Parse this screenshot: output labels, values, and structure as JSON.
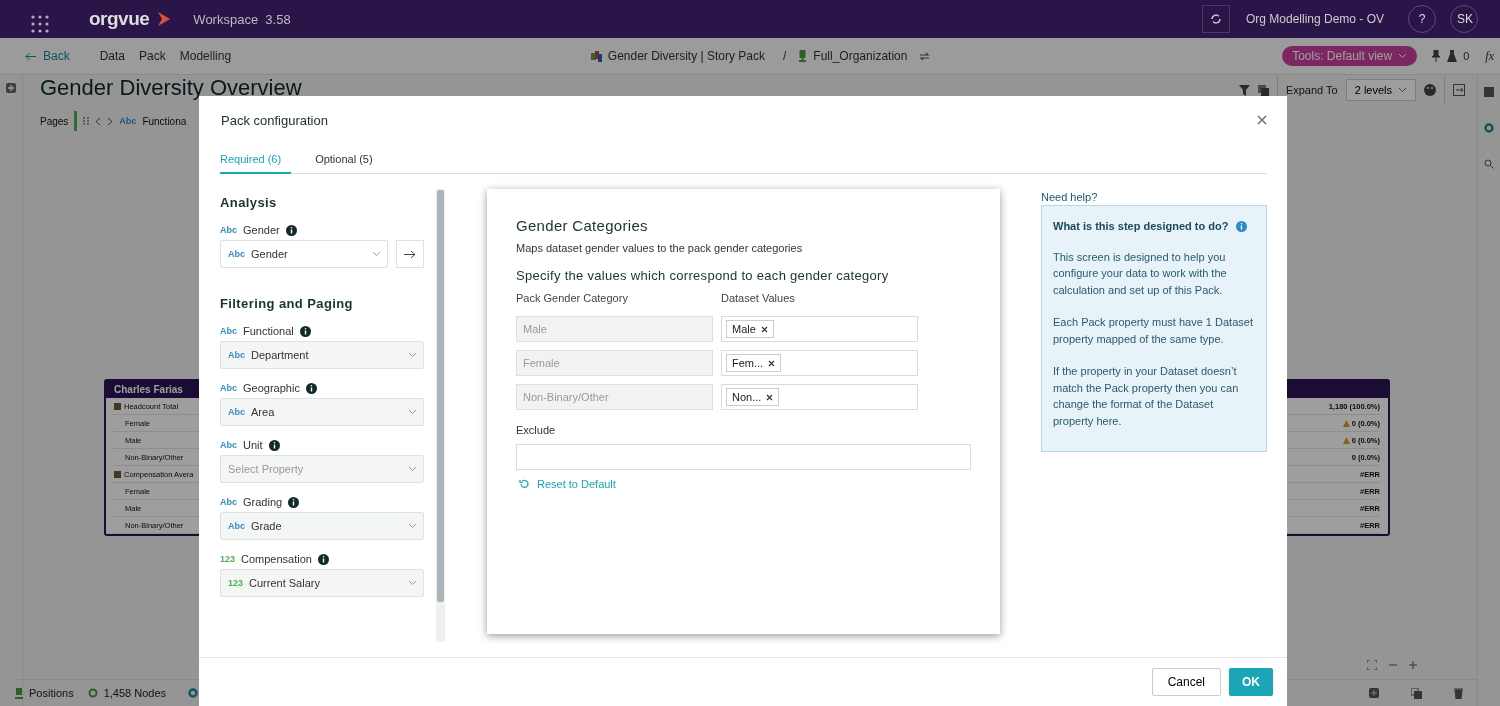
{
  "app_bar": {
    "brand": "orgvue",
    "workspace": "Workspace  3.58",
    "project": "Org Modelling Demo - OV",
    "help": "?",
    "avatar": "SK"
  },
  "nav": {
    "back": "Back",
    "menu": [
      "Data",
      "Pack",
      "Modelling"
    ],
    "pack": "Gender Diversity | Story Pack",
    "separator": "/",
    "dataset": "Full_Organization",
    "tools": "Tools: Default view",
    "flask_count": "0",
    "fx": "fx"
  },
  "page": {
    "title": "Gender Diversity Overview",
    "pages_label": "Pages",
    "page_tag": "Abc",
    "page_name": "Functiona",
    "expand_label": "Expand To",
    "expand_value": "2 levels"
  },
  "node_card": {
    "name": "Charles Farias",
    "rows": [
      {
        "kind": "metric",
        "label": "Headcount Total",
        "value": "1,180 (100.0%)",
        "warning": false
      },
      {
        "kind": "breakdown",
        "label": "Female",
        "value": "0 (0.0%)",
        "warning": true
      },
      {
        "kind": "breakdown",
        "label": "Male",
        "value": "0 (0.0%)",
        "warning": true
      },
      {
        "kind": "breakdown",
        "label": "Non-Binary/Other",
        "value": "0 (0.0%)",
        "warning": false
      },
      {
        "kind": "metric",
        "label": "Compensation Avera",
        "value": "#ERR",
        "warning": false
      },
      {
        "kind": "breakdown",
        "label": "Female",
        "value": "#ERR",
        "warning": false
      },
      {
        "kind": "breakdown",
        "label": "Male",
        "value": "#ERR",
        "warning": false
      },
      {
        "kind": "breakdown",
        "label": "Non-Binary/Other",
        "value": "#ERR",
        "warning": false
      }
    ]
  },
  "status_bar": {
    "positions": "Positions",
    "nodes": "1,458 Nodes"
  },
  "dialog": {
    "title": "Pack configuration",
    "tabs": [
      {
        "label": "Required (6)",
        "selected": true
      },
      {
        "label": "Optional (5)",
        "selected": false
      }
    ],
    "sections": [
      {
        "heading": "Analysis",
        "fields": [
          {
            "type": "Abc",
            "label": "Gender",
            "value_type": "Abc",
            "value": "Gender",
            "active": true
          }
        ]
      },
      {
        "heading": "Filtering and Paging",
        "fields": [
          {
            "type": "Abc",
            "label": "Functional",
            "value_type": "Abc",
            "value": "Department",
            "active": false
          },
          {
            "type": "Abc",
            "label": "Geographic",
            "value_type": "Abc",
            "value": "Area",
            "active": false
          },
          {
            "type": "Abc",
            "label": "Unit",
            "placeholder": "Select Property",
            "active": false
          },
          {
            "type": "Abc",
            "label": "Grading",
            "value_type": "Abc",
            "value": "Grade",
            "active": false
          },
          {
            "type": "123",
            "label": "Compensation",
            "value_type": "123",
            "value": "Current Salary",
            "active": false
          }
        ]
      }
    ],
    "step": {
      "title": "Gender Categories",
      "subtitle": "Maps dataset gender values to the pack gender categories",
      "instruction": "Specify the values which correspond to each gender category",
      "col_category": "Pack Gender Category",
      "col_values": "Dataset Values",
      "rows": [
        {
          "category": "Male",
          "values": [
            "Male"
          ]
        },
        {
          "category": "Female",
          "values": [
            "Fem..."
          ]
        },
        {
          "category": "Non-Binary/Other",
          "values": [
            "Non..."
          ]
        }
      ],
      "exclude_label": "Exclude",
      "reset": "Reset to Default"
    },
    "help": {
      "heading": "Need help?",
      "title": "What is this step designed to do?",
      "paragraphs": [
        "This screen is designed to help you configure your data to work with the calculation and set up of this Pack.",
        "Each Pack property must have 1 Dataset property mapped of the same type.",
        "If the property in your Dataset doesn’t match the Pack property then you can change the format of the Dataset property here."
      ]
    },
    "buttons": {
      "cancel": "Cancel",
      "ok": "OK"
    }
  }
}
